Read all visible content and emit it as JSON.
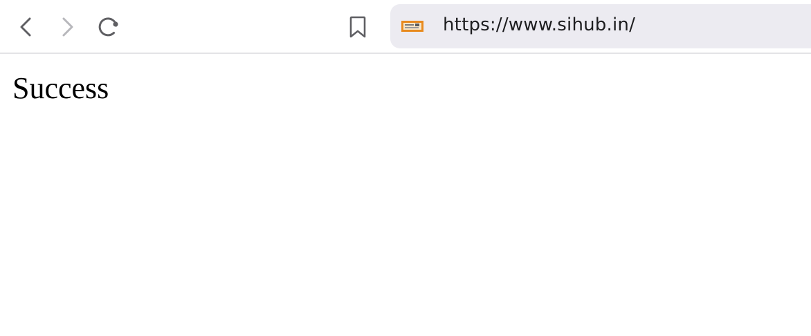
{
  "toolbar": {
    "back_label": "Back",
    "forward_label": "Forward",
    "reload_label": "Reload",
    "bookmark_label": "Bookmark"
  },
  "address_bar": {
    "url": "https://www.sihub.in/",
    "favicon": "site-favicon"
  },
  "icons": {
    "back": "chevron-left-icon",
    "forward": "chevron-right-icon",
    "reload": "reload-icon",
    "bookmark": "bookmark-icon"
  },
  "colors": {
    "icon_active": "#5f5f63",
    "icon_disabled": "#b7b7bb",
    "url_bar_bg": "#ecebf1",
    "favicon_orange": "#e88a1e"
  },
  "page": {
    "heading": "Success"
  }
}
